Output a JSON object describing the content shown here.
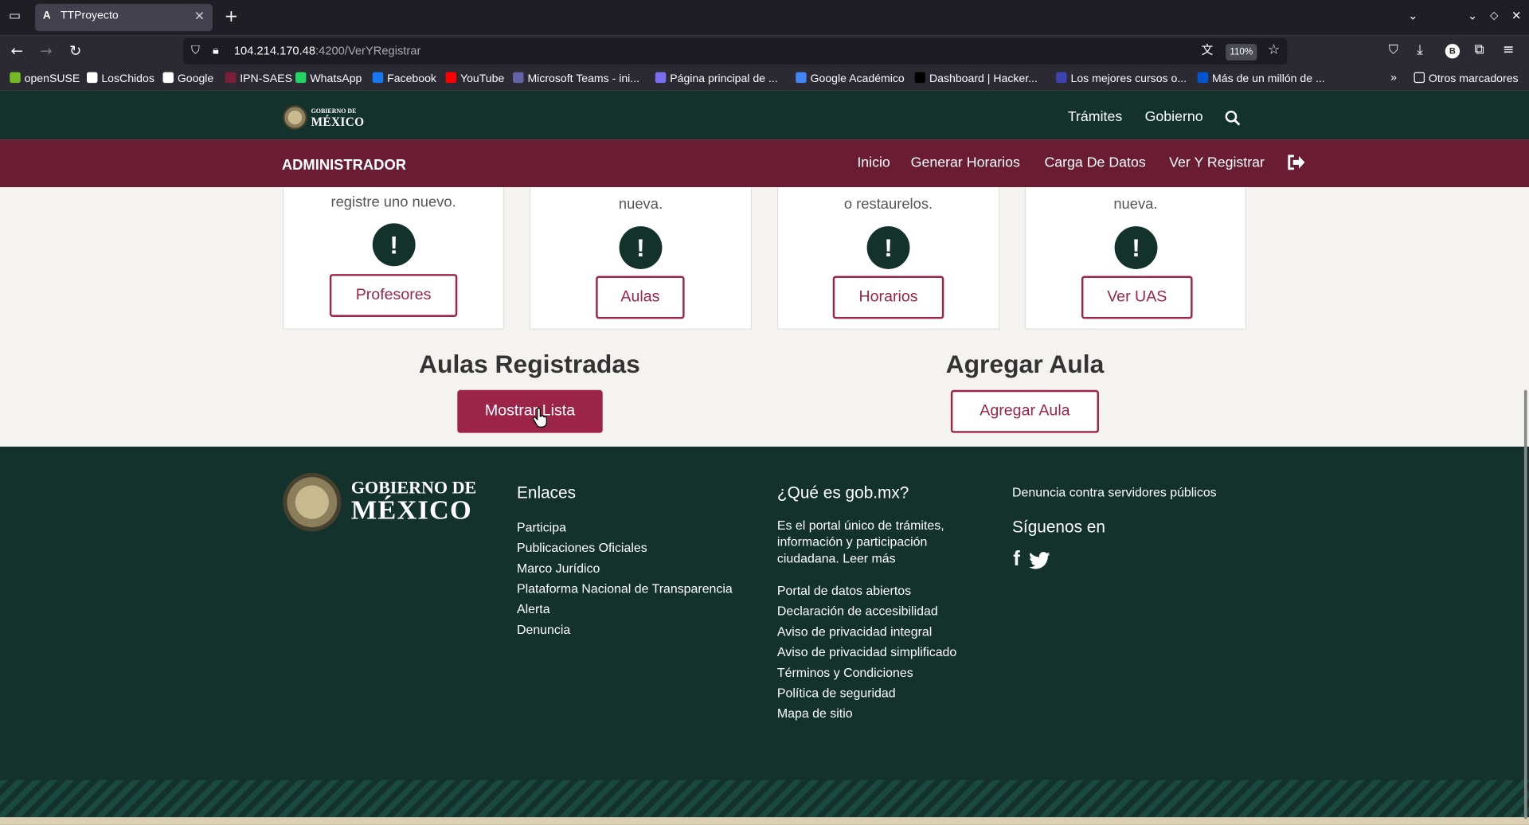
{
  "browser": {
    "tab_title": "TTProyecto",
    "tab_favicon": "A",
    "url_host": "104.214.170.48",
    "url_path": ":4200/VerYRegistrar",
    "zoom": "110%",
    "bookmarks": [
      {
        "label": "openSUSE",
        "color": "#73ba25"
      },
      {
        "label": "LosChidos",
        "color": "#ffffff"
      },
      {
        "label": "Google",
        "color": "#ffffff"
      },
      {
        "label": "IPN-SAES",
        "color": "#7b1e3a"
      },
      {
        "label": "WhatsApp",
        "color": "#25d366"
      },
      {
        "label": "Facebook",
        "color": "#1877f2"
      },
      {
        "label": "YouTube",
        "color": "#ff0000"
      },
      {
        "label": "Microsoft Teams - ini...",
        "color": "#6264a7"
      },
      {
        "label": "Página principal de ...",
        "color": "#7a6ff0"
      },
      {
        "label": "Google Académico",
        "color": "#4285f4"
      },
      {
        "label": "Dashboard | Hacker...",
        "color": "#000000"
      },
      {
        "label": "Los mejores cursos o...",
        "color": "#3d44b0"
      },
      {
        "label": "Más de un millón de ...",
        "color": "#0056d2"
      }
    ],
    "other_bookmarks": "Otros marcadores"
  },
  "header": {
    "logo_small": "GOBIERNO DE",
    "logo_big": "MÉXICO",
    "nav_tramites": "Trámites",
    "nav_gobierno": "Gobierno"
  },
  "admin_bar": {
    "title": "ADMINISTRADOR",
    "nav": [
      "Inicio",
      "Generar Horarios",
      "Carga De Datos",
      "Ver Y Registrar"
    ]
  },
  "cards": [
    {
      "desc": "registre uno nuevo.",
      "button": "Profesores"
    },
    {
      "desc": "nueva.",
      "button": "Aulas"
    },
    {
      "desc": "o restaurelos.",
      "button": "Horarios"
    },
    {
      "desc": "nueva.",
      "button": "Ver UAS"
    }
  ],
  "sections": {
    "left_title": "Aulas Registradas",
    "left_button": "Mostrar Lista",
    "right_title": "Agregar Aula",
    "right_button": "Agregar Aula"
  },
  "footer": {
    "logo_small": "GOBIERNO DE",
    "logo_big": "MÉXICO",
    "enlaces_title": "Enlaces",
    "enlaces": [
      "Participa",
      "Publicaciones Oficiales",
      "Marco Jurídico",
      "Plataforma Nacional de Transparencia",
      "Alerta",
      "Denuncia"
    ],
    "que_es_title": "¿Qué es gob.mx?",
    "que_es_text": [
      "Es el portal único de trámites,",
      "información y participación",
      "ciudadana. Leer más"
    ],
    "links2": [
      "Portal de datos abiertos",
      "Declaración de accesibilidad",
      "Aviso de privacidad integral",
      "Aviso de privacidad simplificado",
      "Términos y Condiciones",
      "Política de seguridad",
      "Mapa de sitio"
    ],
    "denuncia": "Denuncia contra servidores públicos",
    "siguenos": "Síguenos en"
  }
}
